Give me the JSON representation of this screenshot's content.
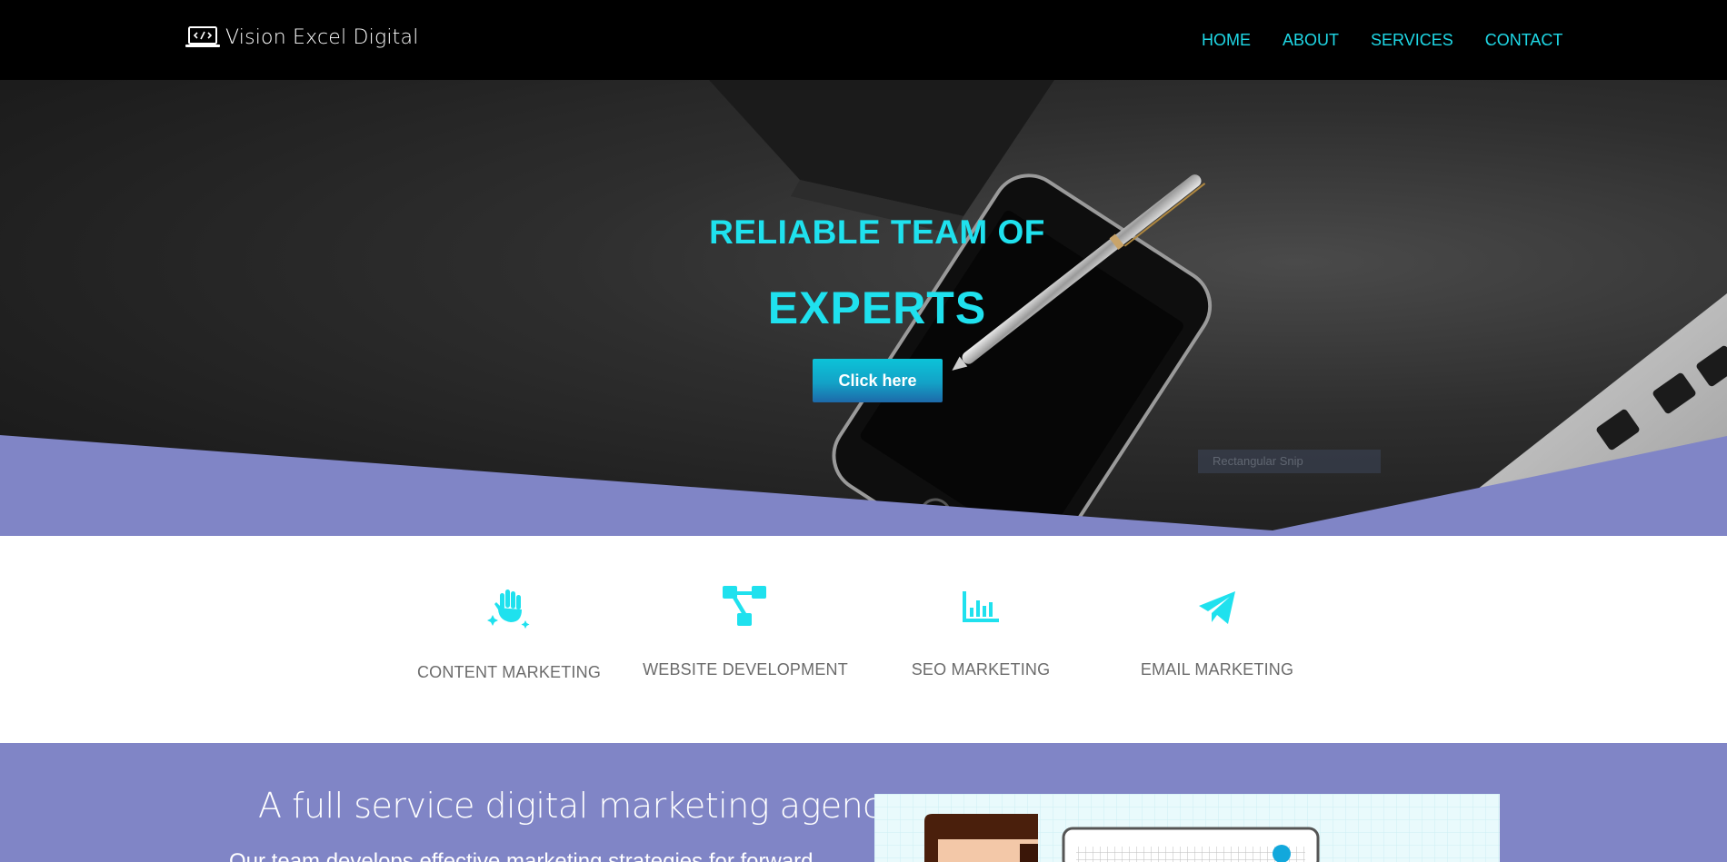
{
  "nav": {
    "brand": "Vision Excel Digital",
    "links": [
      "HOME",
      "ABOUT",
      "SERVICES",
      "CONTACT"
    ]
  },
  "hero": {
    "title_line1": "RELIABLE TEAM OF",
    "title_line2": "EXPERTS",
    "cta_label": "Click here",
    "notice": "Rectangular Snip"
  },
  "services": [
    {
      "label": "CONTENT MARKETING",
      "icon": "sparkle-hand-icon"
    },
    {
      "label": "WEBSITE DEVELOPMENT",
      "icon": "sitemap-icon"
    },
    {
      "label": "SEO MARKETING",
      "icon": "bar-chart-icon"
    },
    {
      "label": "EMAIL MARKETING",
      "icon": "paper-plane-icon"
    }
  ],
  "about": {
    "title": "A full service digital marketing agency",
    "text": "Our team develops effective marketing strategies for forward"
  },
  "colors": {
    "accent": "#1fe1ee",
    "nav_link": "#1fd8e6",
    "purple": "#8085c6",
    "nav_bg": "#000000"
  }
}
